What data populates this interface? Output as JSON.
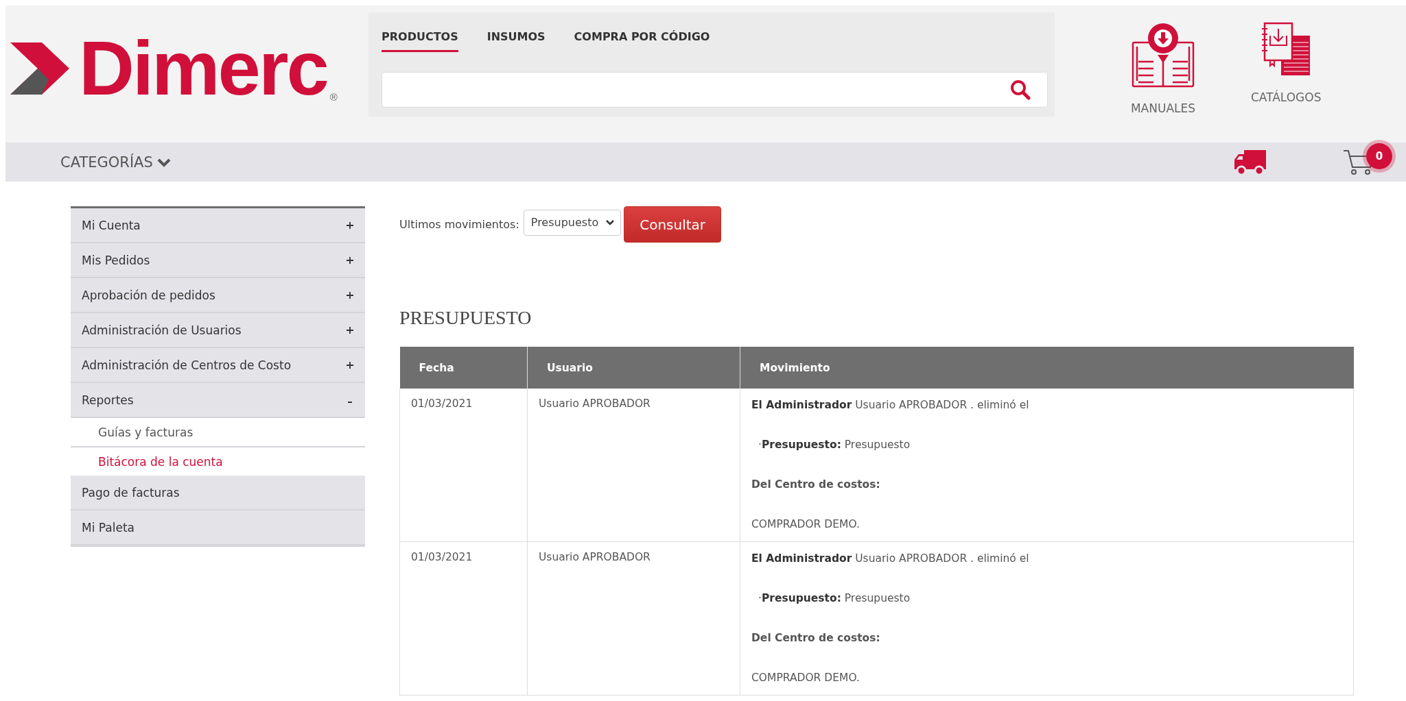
{
  "logo": {
    "text": "Dimerc",
    "mark": "®"
  },
  "search_tabs": [
    {
      "label": "PRODUCTOS",
      "selected": true
    },
    {
      "label": "INSUMOS",
      "selected": false
    },
    {
      "label": "COMPRA POR CÓDIGO",
      "selected": false
    }
  ],
  "header_links": [
    {
      "kind": "manual",
      "label": "MANUALES"
    },
    {
      "kind": "catalog",
      "label": "CATÁLOGOS"
    }
  ],
  "categories": {
    "label": "CATEGORÍAS"
  },
  "cart": {
    "count": "0"
  },
  "sidebar": {
    "items": [
      {
        "label": "Mi Cuenta",
        "kind": "group",
        "expanded": false
      },
      {
        "label": "Mis Pedidos",
        "kind": "group",
        "expanded": false
      },
      {
        "label": "Aprobación de pedidos",
        "kind": "group",
        "expanded": false
      },
      {
        "label": "Administración de Usuarios",
        "kind": "group",
        "expanded": false
      },
      {
        "label": "Administración de Centros de Costo",
        "kind": "group",
        "expanded": false
      },
      {
        "label": "Reportes",
        "kind": "group",
        "expanded": true,
        "children": [
          {
            "label": "Guías y facturas",
            "selected": false
          },
          {
            "label": "Bitácora de la cuenta",
            "selected": true
          }
        ]
      },
      {
        "label": "Pago de facturas",
        "kind": "link"
      },
      {
        "label": "Mi Paleta",
        "kind": "link"
      }
    ]
  },
  "filter": {
    "label": "Ultimos movimientos:",
    "value": "Presupuesto",
    "button": "Consultar"
  },
  "section_title": "PRESUPUESTO",
  "table": {
    "columns": [
      "Fecha",
      "Usuario",
      "Movimiento"
    ],
    "rows": [
      {
        "fecha": "01/03/2021",
        "usuario": "Usuario APROBADOR",
        "movimiento": [
          {
            "kind": "text",
            "text": "**El Administrador** Usuario APROBADOR . eliminó el"
          },
          {
            "kind": "bullet",
            "text": "·**Presupuesto:** Presupuesto"
          },
          {
            "kind": "heading",
            "text": "Del Centro de costos:"
          },
          {
            "kind": "text",
            "text": "COMPRADOR DEMO."
          }
        ]
      },
      {
        "fecha": "01/03/2021",
        "usuario": "Usuario APROBADOR",
        "movimiento": [
          {
            "kind": "text",
            "text": "**El Administrador** Usuario APROBADOR . eliminó el"
          },
          {
            "kind": "bullet",
            "text": "·**Presupuesto:** Presupuesto"
          },
          {
            "kind": "heading",
            "text": "Del Centro de costos:"
          },
          {
            "kind": "text",
            "text": "COMPRADOR DEMO."
          }
        ]
      }
    ]
  }
}
